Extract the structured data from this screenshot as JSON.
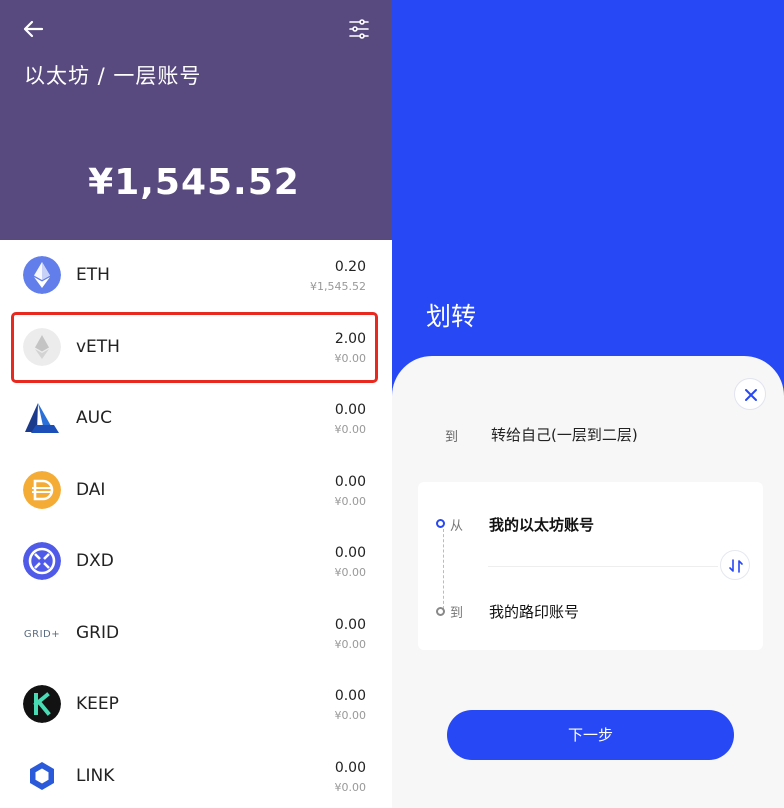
{
  "left": {
    "title": "以太坊 / 一层账号",
    "total": "¥1,545.52",
    "assets": [
      {
        "symbol": "ETH",
        "amount": "0.20",
        "fiat": "¥1,545.52",
        "icon": "eth-icon"
      },
      {
        "symbol": "vETH",
        "amount": "2.00",
        "fiat": "¥0.00",
        "icon": "veth-icon"
      },
      {
        "symbol": "AUC",
        "amount": "0.00",
        "fiat": "¥0.00",
        "icon": "auc-icon"
      },
      {
        "symbol": "DAI",
        "amount": "0.00",
        "fiat": "¥0.00",
        "icon": "dai-icon"
      },
      {
        "symbol": "DXD",
        "amount": "0.00",
        "fiat": "¥0.00",
        "icon": "dxd-icon"
      },
      {
        "symbol": "GRID",
        "amount": "0.00",
        "fiat": "¥0.00",
        "icon": "grid-icon"
      },
      {
        "symbol": "KEEP",
        "amount": "0.00",
        "fiat": "¥0.00",
        "icon": "keep-icon"
      },
      {
        "symbol": "LINK",
        "amount": "0.00",
        "fiat": "¥0.00",
        "icon": "link-icon"
      }
    ],
    "grid_logo_text": "GRID+"
  },
  "right": {
    "title": "划转",
    "to_label": "到",
    "to_value": "转给自己(一层到二层)",
    "from_label": "从",
    "from_value": "我的以太坊账号",
    "to2_label": "到",
    "to2_value": "我的路印账号",
    "next_label": "下一步"
  },
  "colors": {
    "header_purple": "#584a7e",
    "accent_blue": "#2748f5",
    "highlight_red": "#e8291f"
  }
}
